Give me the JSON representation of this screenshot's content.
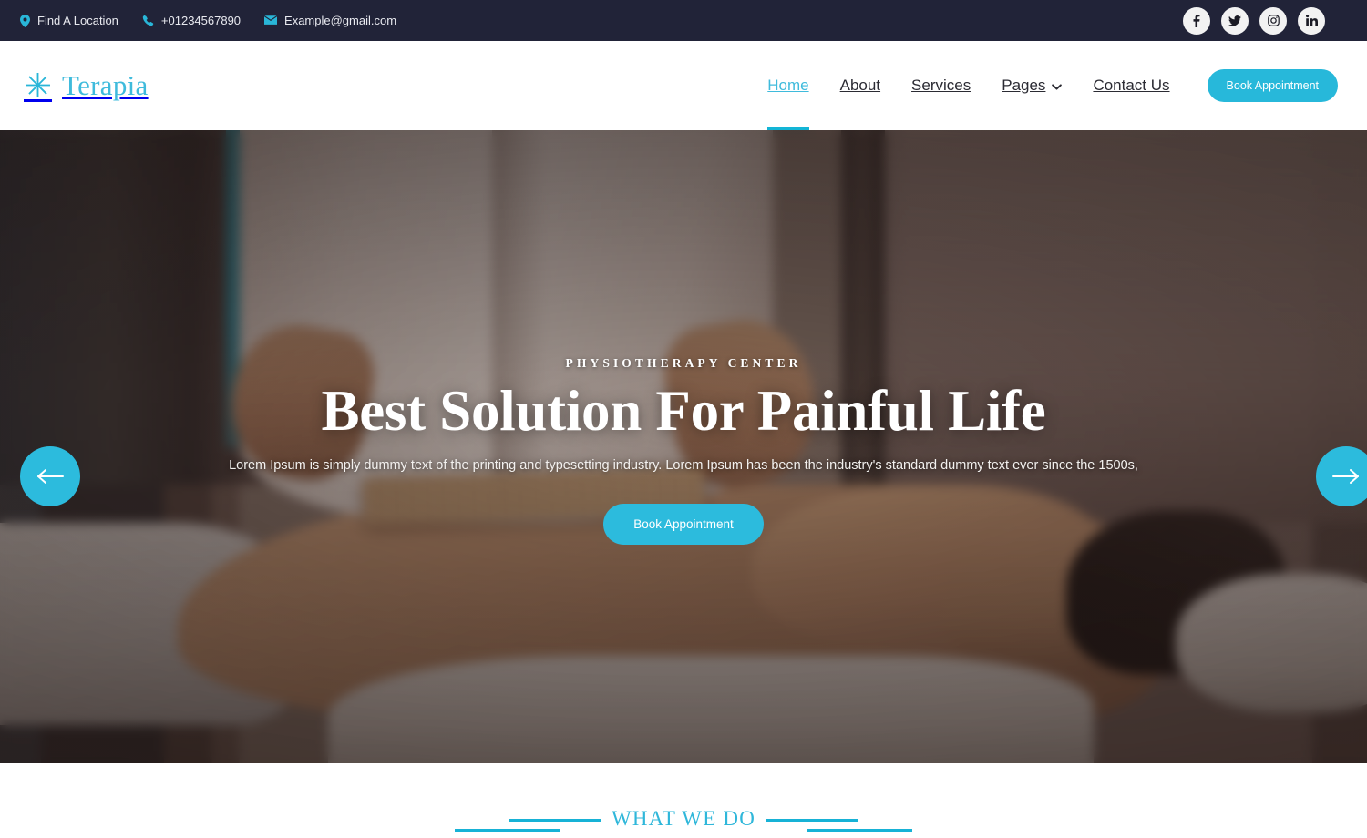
{
  "topbar": {
    "location": "Find A Location",
    "phone": "+01234567890",
    "email": "Example@gmail.com",
    "location_icon": "map-pin-icon",
    "phone_icon": "phone-icon",
    "email_icon": "envelope-icon",
    "socials": [
      {
        "name": "facebook-icon",
        "label": "f"
      },
      {
        "name": "twitter-icon",
        "label": "t"
      },
      {
        "name": "instagram-icon",
        "label": "ig"
      },
      {
        "name": "linkedin-icon",
        "label": "in"
      }
    ],
    "background": "#212338",
    "accent": "#29b6d8"
  },
  "header": {
    "logo_mark": "✳",
    "logo_text": "Terapia",
    "nav": [
      {
        "label": "Home",
        "active": true,
        "has_dropdown": false
      },
      {
        "label": "About",
        "active": false,
        "has_dropdown": false
      },
      {
        "label": "Services",
        "active": false,
        "has_dropdown": false
      },
      {
        "label": "Pages",
        "active": false,
        "has_dropdown": true
      },
      {
        "label": "Contact Us",
        "active": false,
        "has_dropdown": false
      }
    ],
    "cta_label": "Book Appointment",
    "accent": "#27b8da"
  },
  "hero": {
    "eyebrow": "PHYSIOTHERAPY CENTER",
    "title": "Best Solution For Painful Life",
    "subtitle": "Lorem Ipsum is simply dummy text of the printing and typesetting industry. Lorem Ipsum has been the industry's standard dummy text ever since the 1500s,",
    "cta_label": "Book Appointment",
    "prev_icon": "arrow-left-icon",
    "next_icon": "arrow-right-icon",
    "accent": "#2cbbdd"
  },
  "what_we_do": {
    "title": "WHAT WE DO",
    "accent": "#17b2d6"
  }
}
